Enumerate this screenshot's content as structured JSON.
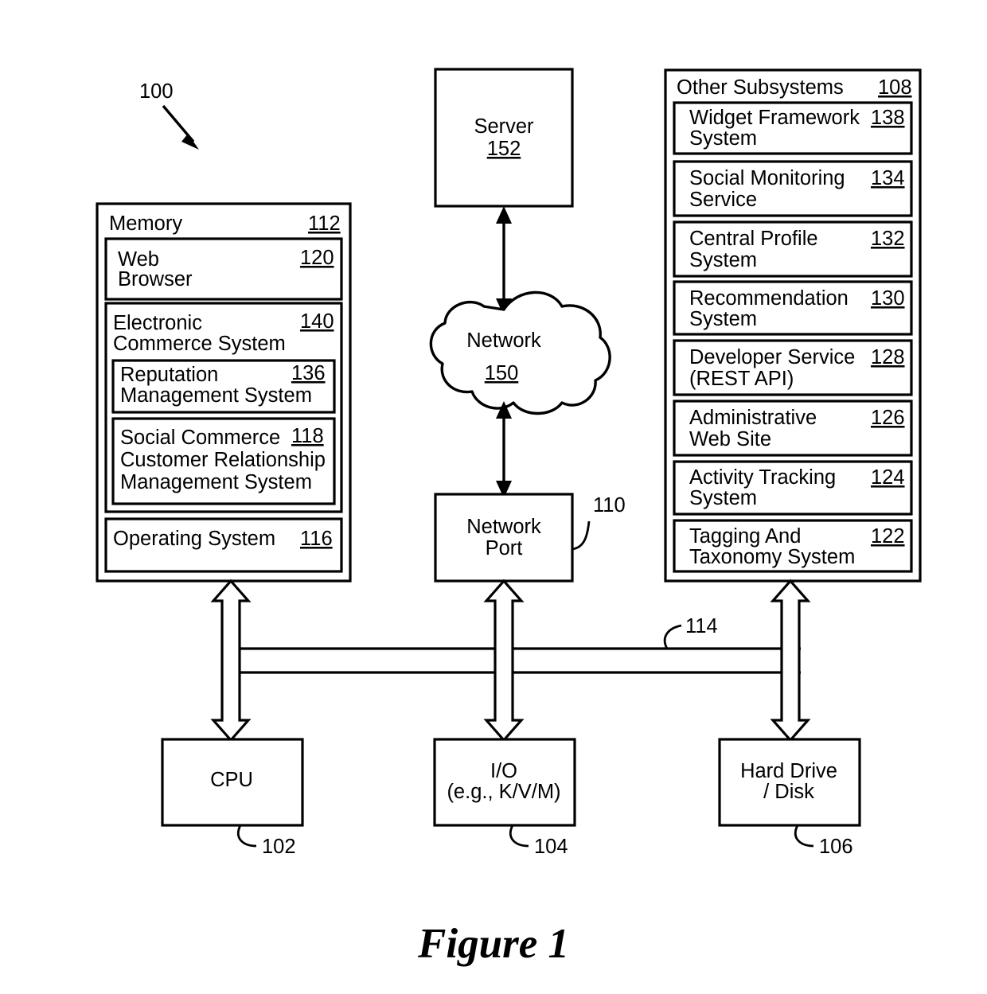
{
  "figure": {
    "caption": "Figure 1",
    "system_ref": "100"
  },
  "memory": {
    "title": "Memory",
    "ref": "112",
    "modules": [
      {
        "lines": [
          "Web",
          "Browser"
        ],
        "ref": "120"
      },
      {
        "lines": [
          "Electronic",
          "Commerce System"
        ],
        "ref": "140"
      },
      {
        "lines": [
          "Reputation",
          "Management System"
        ],
        "ref": "136"
      },
      {
        "lines": [
          "Social Commerce",
          "Customer Relationship",
          "Management System"
        ],
        "ref": "118"
      },
      {
        "lines": [
          "Operating System"
        ],
        "ref": "116"
      }
    ]
  },
  "subsystems": {
    "title": "Other Subsystems",
    "ref": "108",
    "items": [
      {
        "lines": [
          "Widget Framework",
          "System"
        ],
        "ref": "138"
      },
      {
        "lines": [
          "Social Monitoring",
          "Service"
        ],
        "ref": "134"
      },
      {
        "lines": [
          "Central Profile",
          "System"
        ],
        "ref": "132"
      },
      {
        "lines": [
          "Recommendation",
          "System"
        ],
        "ref": "130"
      },
      {
        "lines": [
          "Developer Service",
          "(REST API)"
        ],
        "ref": "128"
      },
      {
        "lines": [
          "Administrative",
          "Web Site"
        ],
        "ref": "126"
      },
      {
        "lines": [
          "Activity Tracking",
          "System"
        ],
        "ref": "124"
      },
      {
        "lines": [
          "Tagging And",
          "Taxonomy System"
        ],
        "ref": "122"
      }
    ]
  },
  "server": {
    "label": "Server",
    "ref": "152"
  },
  "network": {
    "label": "Network",
    "ref": "150"
  },
  "network_port": {
    "line1": "Network",
    "line2": "Port",
    "ref": "110"
  },
  "bus": {
    "ref": "114"
  },
  "hardware": [
    {
      "lines": [
        "CPU"
      ],
      "ref": "102"
    },
    {
      "lines": [
        "I/O",
        "(e.g., K/V/M)"
      ],
      "ref": "104"
    },
    {
      "lines": [
        "Hard Drive",
        "/ Disk"
      ],
      "ref": "106"
    }
  ]
}
